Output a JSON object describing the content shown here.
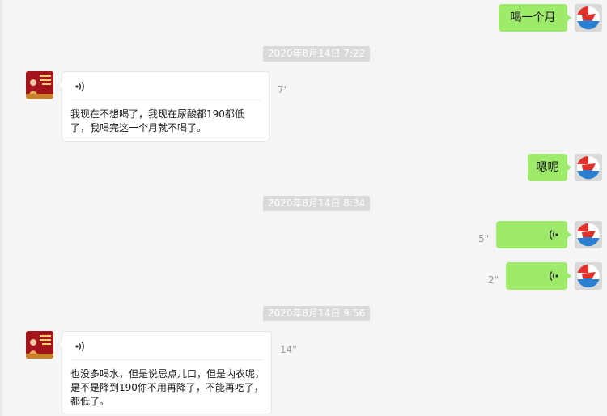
{
  "messages": [
    {
      "side": "me",
      "type": "text",
      "text": "喝一个月"
    },
    {
      "type": "timestamp",
      "text": "2020年8月14日 7:22"
    },
    {
      "side": "other",
      "type": "voice",
      "duration": "7\"",
      "transcript": "我现在不想喝了，我现在尿酸都190都低了，我喝完这一个月就不喝了。"
    },
    {
      "side": "me",
      "type": "text",
      "text": "嗯呢"
    },
    {
      "type": "timestamp",
      "text": "2020年8月14日 8:34"
    },
    {
      "side": "me",
      "type": "voice",
      "duration": "5\""
    },
    {
      "side": "me",
      "type": "voice",
      "duration": "2\""
    },
    {
      "type": "timestamp",
      "text": "2020年8月14日 9:56"
    },
    {
      "side": "other",
      "type": "voice",
      "duration": "14\"",
      "transcript": "也没多喝水，但是说忌点儿口，但是内衣呢，是不是降到190你不用再降了，不能再吃了，都低了。"
    }
  ],
  "colors": {
    "background": "#f5f5f5",
    "my_bubble": "#9eea6a",
    "their_bubble": "#ffffff",
    "timestamp_bg": "#dadada"
  },
  "icons": {
    "voice_incoming": "voice-wave-icon",
    "voice_outgoing": "voice-wave-icon",
    "avatar_me": "app-logo-avatar"
  }
}
